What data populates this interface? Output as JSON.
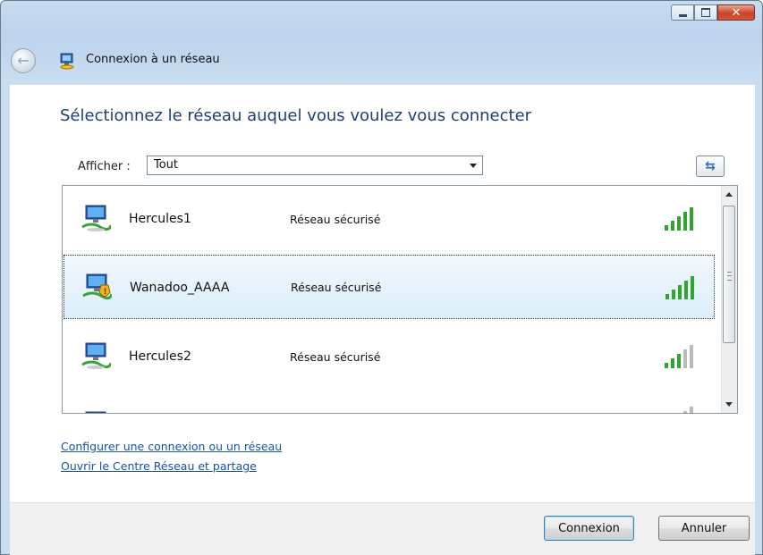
{
  "window": {
    "title": "Connexion à un réseau",
    "caption_buttons": [
      "minimize",
      "maximize",
      "close"
    ],
    "close_glyph": "✕"
  },
  "heading": "Sélectionnez le réseau auquel vous voulez vous connecter",
  "filter": {
    "label": "Afficher :",
    "value": "Tout",
    "refresh_glyph": "⇆"
  },
  "networks": [
    {
      "name": "Hercules1",
      "status": "Réseau sécurisé",
      "icon": "secured-network-icon",
      "signal_bars": 5
    },
    {
      "name": "Wanadoo_AAAA",
      "status": "Réseau sécurisé",
      "icon": "warning-network-icon",
      "signal_bars": 5,
      "selected": true
    },
    {
      "name": "Hercules2",
      "status": "Réseau sécurisé",
      "icon": "secured-network-icon",
      "signal_bars": 3
    },
    {
      "name": "",
      "status": "",
      "icon": "network-icon",
      "signal_bars": 1
    }
  ],
  "links": {
    "setup": "Configurer une connexion ou un réseau",
    "network_center": "Ouvrir le Centre Réseau et partage"
  },
  "buttons": {
    "connect": "Connexion",
    "cancel": "Annuler"
  },
  "colors": {
    "heading": "#1f3d7a",
    "link": "#1551b0",
    "signal_active": "#2ea52e",
    "signal_inactive": "#b9b9b9"
  }
}
